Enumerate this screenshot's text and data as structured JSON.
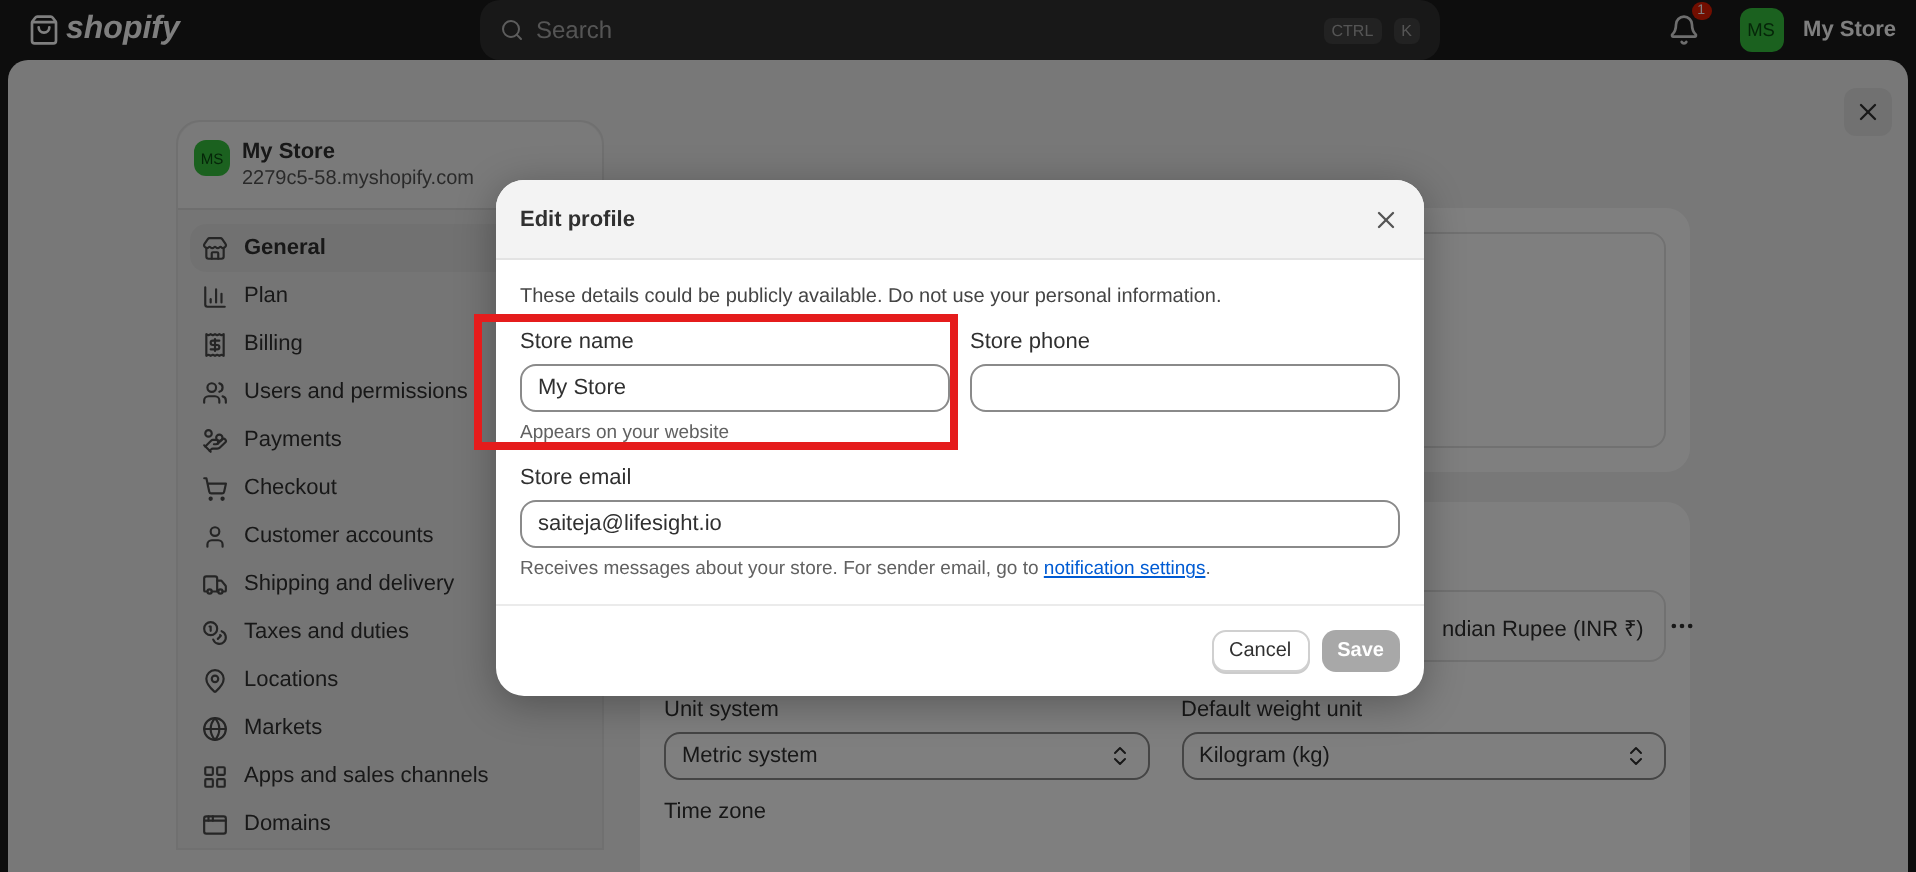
{
  "topbar": {
    "logo": "shopify",
    "search": {
      "placeholder": "Search",
      "keys": [
        "CTRL",
        "K"
      ]
    },
    "notification_count": "1",
    "store": {
      "avatar": "MS",
      "name": "My Store"
    }
  },
  "sidebar": {
    "store": {
      "avatar": "MS",
      "name": "My Store",
      "domain": "2279c5-58.myshopify.com"
    },
    "items": [
      {
        "label": "General",
        "selected": true
      },
      {
        "label": "Plan",
        "selected": false
      },
      {
        "label": "Billing",
        "selected": false
      },
      {
        "label": "Users and permissions",
        "selected": false
      },
      {
        "label": "Payments",
        "selected": false
      },
      {
        "label": "Checkout",
        "selected": false
      },
      {
        "label": "Customer accounts",
        "selected": false
      },
      {
        "label": "Shipping and delivery",
        "selected": false
      },
      {
        "label": "Taxes and duties",
        "selected": false
      },
      {
        "label": "Locations",
        "selected": false
      },
      {
        "label": "Markets",
        "selected": false
      },
      {
        "label": "Apps and sales channels",
        "selected": false
      },
      {
        "label": "Domains",
        "selected": false
      }
    ]
  },
  "main": {
    "currency": "ndian Rupee (INR ₹)",
    "selects": [
      {
        "label": "Unit system",
        "value": "Metric system"
      },
      {
        "label": "Default weight unit",
        "value": "Kilogram (kg)"
      }
    ],
    "time_zone_label": "Time zone"
  },
  "modal": {
    "title": "Edit profile",
    "notice": "These details could be publicly available. Do not use your personal information.",
    "fields": [
      {
        "label": "Store name",
        "value": "My Store",
        "help": "Appears on your website",
        "highlighted": true
      },
      {
        "label": "Store phone",
        "highlighted": false
      }
    ],
    "email": {
      "label": "Store email",
      "value": "saiteja@lifesight.io",
      "help": "Receives messages about your store. For sender email, go to",
      "link": "notification settings",
      "help_end": "."
    },
    "buttons": [
      {
        "label": "Cancel",
        "disabled": false
      },
      {
        "label": "Save",
        "disabled": true
      }
    ]
  }
}
